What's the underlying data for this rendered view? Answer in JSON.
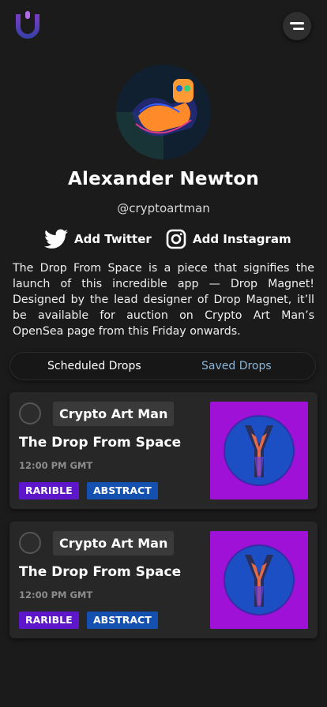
{
  "header": {
    "logo_icon": "drop-magnet-logo-icon",
    "menu_icon": "menu-icon"
  },
  "profile": {
    "name": "Alexander Newton",
    "handle": "@cryptoartman",
    "avatar_icon": "avatar-image",
    "twitter_label": "Add Twitter",
    "instagram_label": "Add Instagram",
    "bio": "The Drop From Space is a piece that signifies the launch of this incredible app — Drop Magnet! Designed by the lead designer of Drop Magnet, it’ll be available for auction on Crypto Art Man’s OpenSea page from this Friday onwards."
  },
  "tabs": {
    "scheduled": "Scheduled Drops",
    "saved": "Saved Drops"
  },
  "drops": [
    {
      "creator": "Crypto Art Man",
      "title": "The Drop From Space",
      "time": "12:00 PM GMT",
      "tags": [
        "RARIBLE",
        "ABSTRACT"
      ]
    },
    {
      "creator": "Crypto Art Man",
      "title": "The Drop From Space",
      "time": "12:00 PM GMT",
      "tags": [
        "RARIBLE",
        "ABSTRACT"
      ]
    }
  ],
  "colors": {
    "background": "#1b1b1b",
    "card": "#272727",
    "rarible_tag": "#5d16c9",
    "abstract_tag": "#1450b0",
    "art_background": "#a011d8",
    "saved_tab_text": "#8bb6d6"
  }
}
